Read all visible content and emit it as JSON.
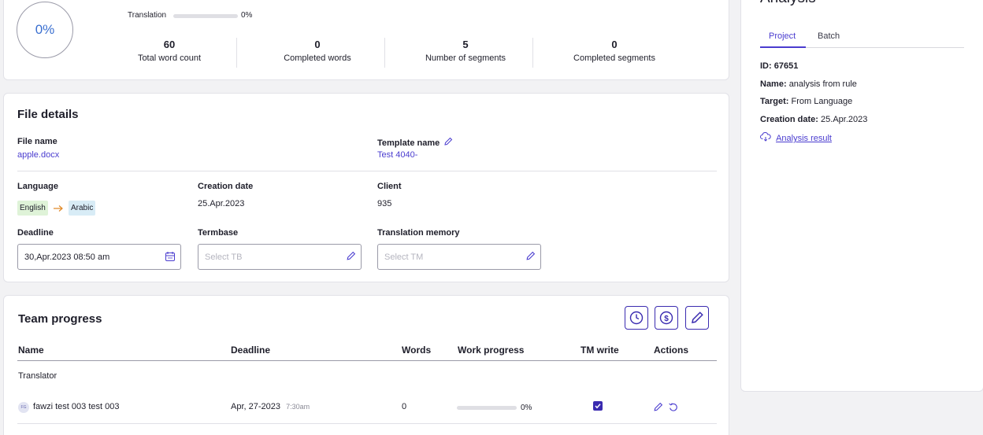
{
  "stats": {
    "percent": "0%",
    "translation_label": "Translation",
    "translation_pct": "0%",
    "translation_progress": 0,
    "items": [
      {
        "value": "60",
        "label": "Total word count"
      },
      {
        "value": "0",
        "label": "Completed words"
      },
      {
        "value": "5",
        "label": "Number of segments"
      },
      {
        "value": "0",
        "label": "Completed segments"
      }
    ]
  },
  "file_details": {
    "title": "File details",
    "file_name_label": "File name",
    "file_name": "apple.docx",
    "template_label": "Template name",
    "template_value": "Test 4040-",
    "language_label": "Language",
    "source_lang": "English",
    "target_lang": "Arabic",
    "creation_label": "Creation date",
    "creation_value": "25.Apr.2023",
    "client_label": "Client",
    "client_value": "935",
    "deadline_label": "Deadline",
    "deadline_value": "30,Apr.2023 08:50 am",
    "termbase_label": "Termbase",
    "termbase_placeholder": "Select TB",
    "tm_label": "Translation memory",
    "tm_placeholder": "Select TM"
  },
  "team": {
    "title": "Team progress",
    "columns": [
      "Name",
      "Deadline",
      "Words",
      "Work progress",
      "TM write",
      "Actions"
    ],
    "group": "Translator",
    "rows": [
      {
        "initials": "FG",
        "name": "fawzi test 003 test 003",
        "deadline": "Apr, 27-2023",
        "time": "7:30am",
        "words": "0",
        "progress_pct": "0%",
        "progress": 0,
        "tm_write": true
      }
    ]
  },
  "analysis": {
    "title": "Analysis",
    "tabs": [
      "Project",
      "Batch"
    ],
    "active_tab": "Project",
    "id_label": "ID:",
    "id_value": "67651",
    "name_label": "Name:",
    "name_value": "analysis from rule",
    "target_label": "Target:",
    "target_value": "From Language",
    "creation_label": "Creation date:",
    "creation_value": "25.Apr.2023",
    "result_link": "Analysis result"
  },
  "colors": {
    "accent": "#4a3ccf",
    "button_border": "#3a2bb0",
    "source_chip": "#dff3d8",
    "target_chip": "#d8ecf6",
    "arrow": "#e08a2a"
  }
}
